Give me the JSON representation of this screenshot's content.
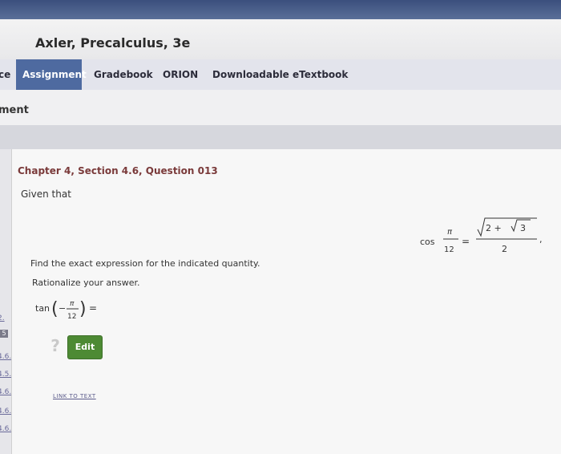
{
  "header": {
    "course_title": "Axler, Precalculus, 3e"
  },
  "tabs": [
    {
      "label": "ce"
    },
    {
      "label": "Assignment"
    },
    {
      "label": "Gradebook"
    },
    {
      "label": "ORION"
    },
    {
      "label": "Downloadable eTextbook"
    }
  ],
  "subheader": {
    "label": "ment"
  },
  "sidebar": {
    "links": [
      "2.",
      "5",
      "4.6.",
      "4.5.",
      "4.6.",
      "4.6.",
      "4.6."
    ]
  },
  "question": {
    "title": "Chapter 4, Section 4.6, Question 013",
    "intro": "Given that",
    "given": {
      "func": "cos",
      "num": "π",
      "den": "12",
      "rad_outer": "2 +",
      "rad_inner": "3",
      "res_den": "2"
    },
    "instruction1": "Find the exact expression for the indicated quantity.",
    "instruction2": "Rationalize your answer.",
    "answer": {
      "func": "tan",
      "sign": "−",
      "num": "π",
      "den": "12",
      "eq": "="
    }
  },
  "buttons": {
    "help": "?",
    "edit": "Edit",
    "link_text": "LINK TO TEXT"
  }
}
